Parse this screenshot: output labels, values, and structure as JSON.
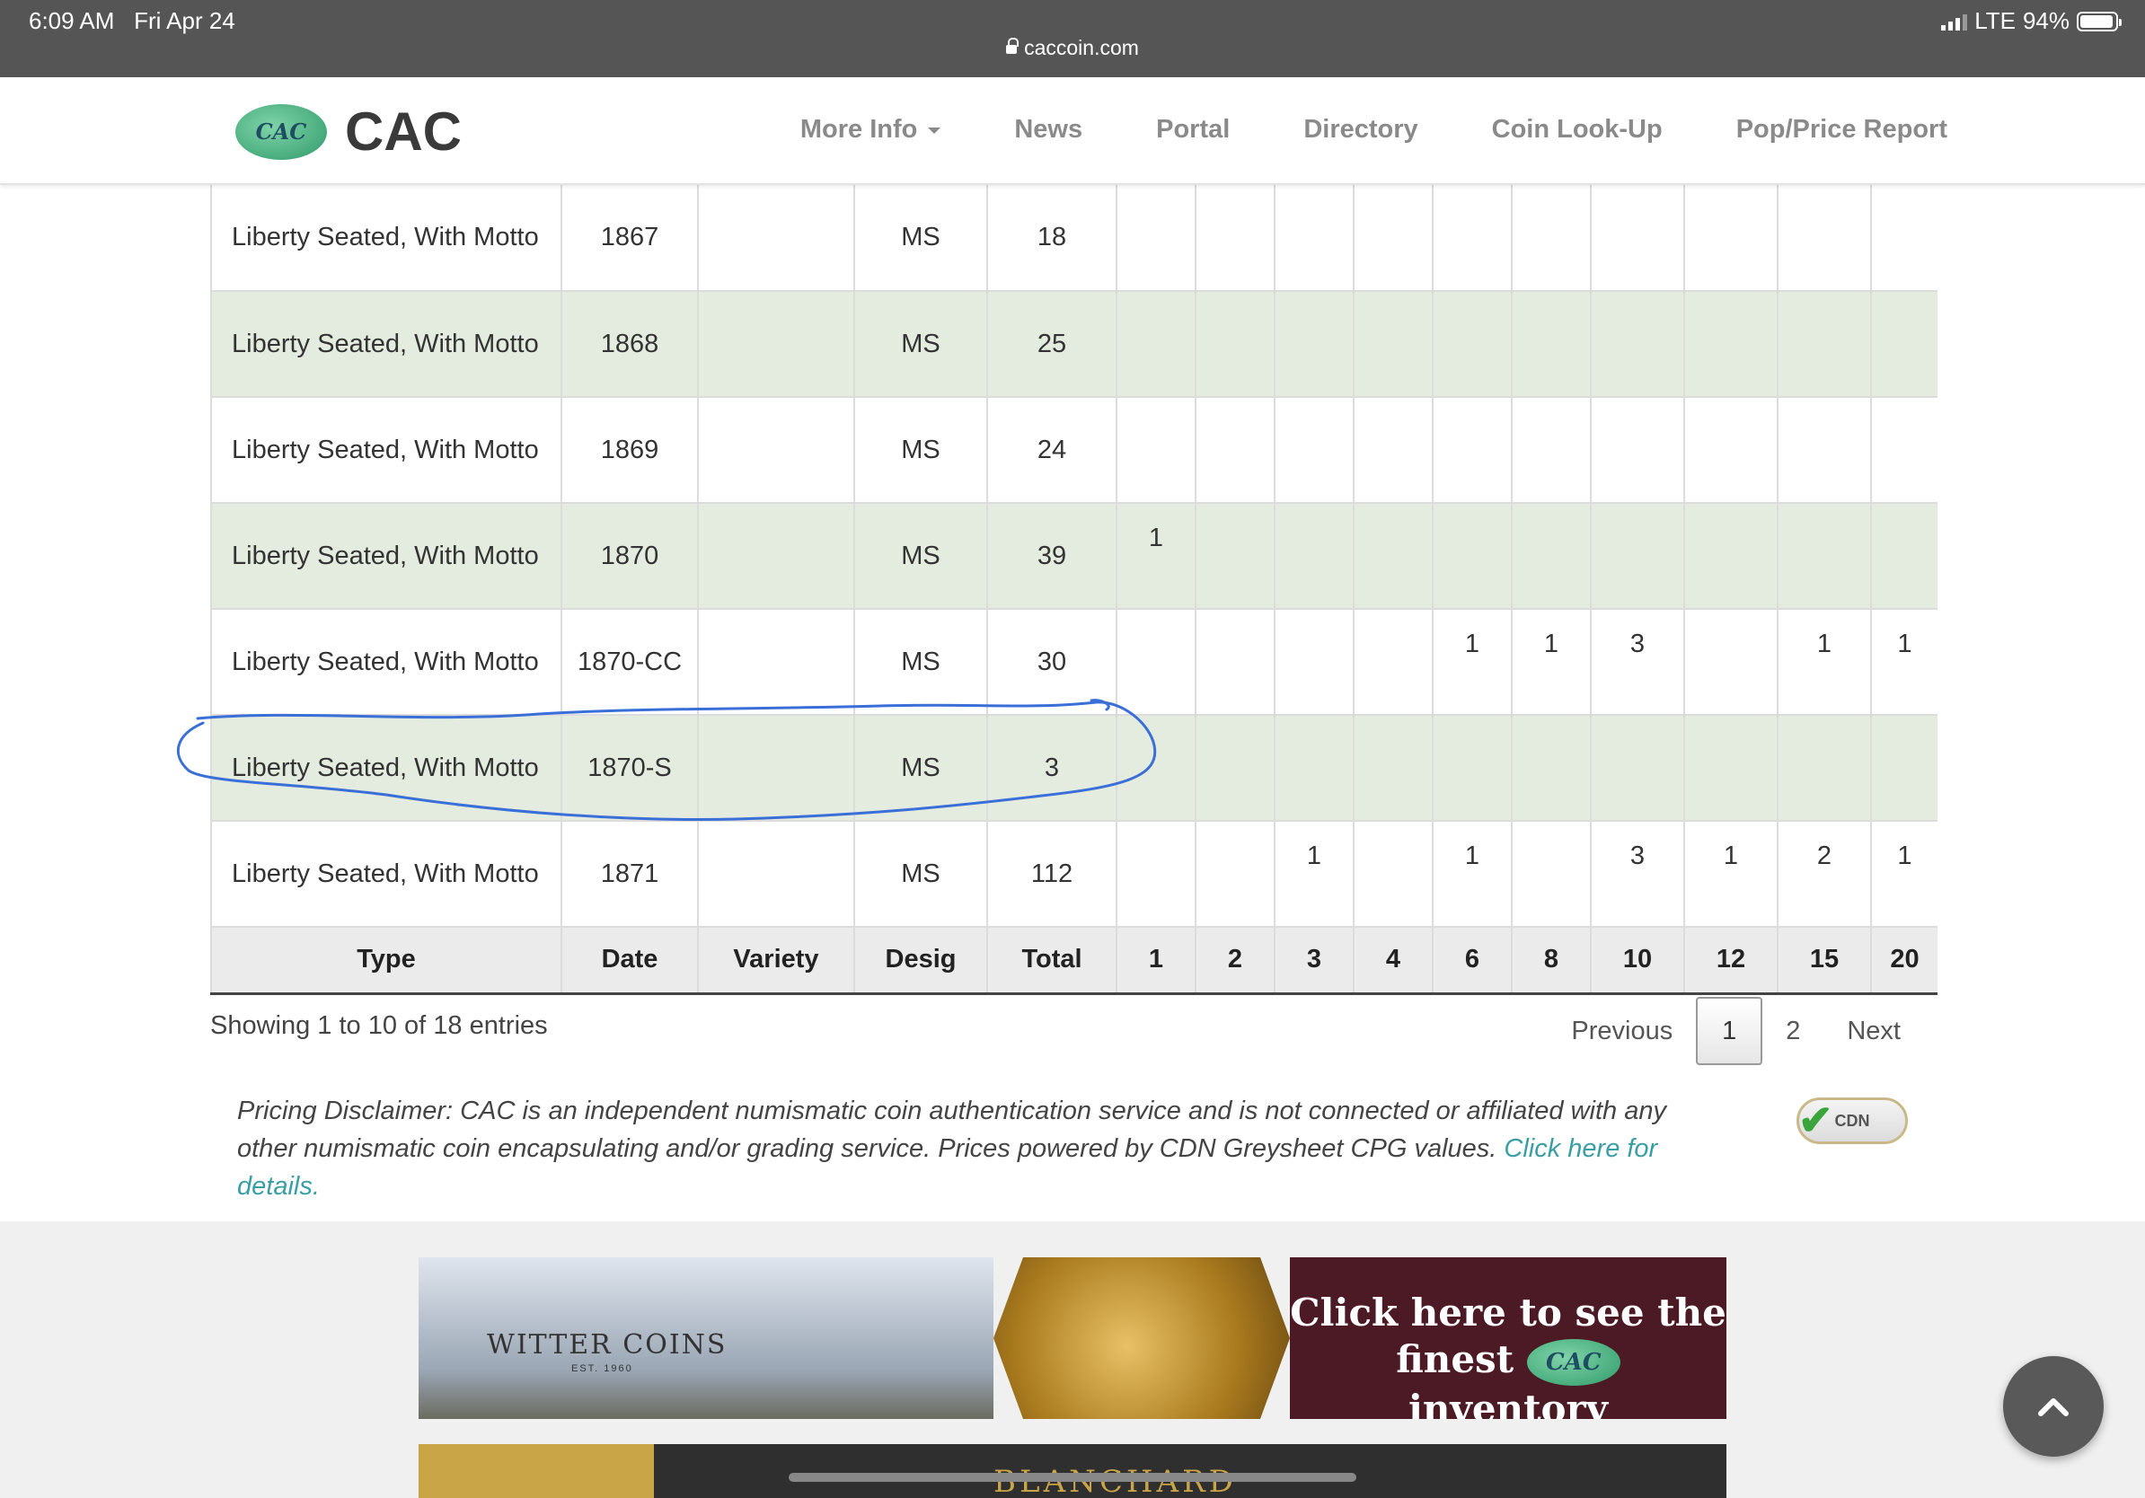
{
  "status_bar": {
    "time": "6:09 AM",
    "date": "Fri Apr 24",
    "url": "caccoin.com",
    "network": "LTE",
    "battery": "94%"
  },
  "nav": {
    "logo_mark": "CAC",
    "logo_text": "CAC",
    "links": [
      "More Info",
      "News",
      "Portal",
      "Directory",
      "Coin Look-Up",
      "Pop/Price Report"
    ]
  },
  "table": {
    "headers": [
      "Type",
      "Date",
      "Variety",
      "Desig",
      "Total",
      "1",
      "2",
      "3",
      "4",
      "6",
      "8",
      "10",
      "12",
      "15",
      "20"
    ],
    "rows": [
      {
        "type": "Liberty Seated, With Motto",
        "date": "1867",
        "variety": "",
        "desig": "MS",
        "total": "18",
        "cells": [
          "",
          "",
          "",
          "",
          "",
          "",
          "",
          "",
          "",
          ""
        ]
      },
      {
        "type": "Liberty Seated, With Motto",
        "date": "1868",
        "variety": "",
        "desig": "MS",
        "total": "25",
        "cells": [
          "",
          "",
          "",
          "",
          "",
          "",
          "",
          "",
          "",
          ""
        ]
      },
      {
        "type": "Liberty Seated, With Motto",
        "date": "1869",
        "variety": "",
        "desig": "MS",
        "total": "24",
        "cells": [
          "",
          "",
          "",
          "",
          "",
          "",
          "",
          "",
          "",
          ""
        ]
      },
      {
        "type": "Liberty Seated, With Motto",
        "date": "1870",
        "variety": "",
        "desig": "MS",
        "total": "39",
        "cells": [
          "1",
          "",
          "",
          "",
          "",
          "",
          "",
          "",
          "",
          ""
        ]
      },
      {
        "type": "Liberty Seated, With Motto",
        "date": "1870-CC",
        "variety": "",
        "desig": "MS",
        "total": "30",
        "cells": [
          "",
          "",
          "",
          "",
          "1",
          "1",
          "3",
          "",
          "1",
          "1"
        ]
      },
      {
        "type": "Liberty Seated, With Motto",
        "date": "1870-S",
        "variety": "",
        "desig": "MS",
        "total": "3",
        "cells": [
          "",
          "",
          "",
          "",
          "",
          "",
          "",
          "",
          "",
          ""
        ]
      },
      {
        "type": "Liberty Seated, With Motto",
        "date": "1871",
        "variety": "",
        "desig": "MS",
        "total": "112",
        "cells": [
          "",
          "",
          "1",
          "",
          "1",
          "",
          "3",
          "1",
          "2",
          "1"
        ]
      }
    ]
  },
  "table_info": "Showing 1 to 10 of 18 entries",
  "pagination": {
    "previous": "Previous",
    "pages": [
      "1",
      "2"
    ],
    "current": "1",
    "next": "Next"
  },
  "disclaimer": {
    "text": "Pricing Disclaimer: CAC is an independent numismatic coin authentication service and is not connected or affiliated with any other numismatic coin encapsulating and/or grading service. Prices powered by CDN Greysheet CPG values.",
    "link": "Click here for details.",
    "badge": "CDN"
  },
  "banner1": {
    "brand": "WITTER COINS",
    "est": "EST. 1960",
    "cta_line1": "Click here to see the",
    "cta_line2_a": "finest",
    "cta_mark": "CAC",
    "cta_line2_b": "inventory"
  },
  "banner2": {
    "brand": "BLANCHARD"
  },
  "colors": {
    "status_bar": "#555555",
    "row_alt": "#e3ecdf",
    "link": "#3a9ea5",
    "annotation": "#3b6fd8"
  },
  "icons": {
    "scroll_top": "chevron-up-icon"
  }
}
